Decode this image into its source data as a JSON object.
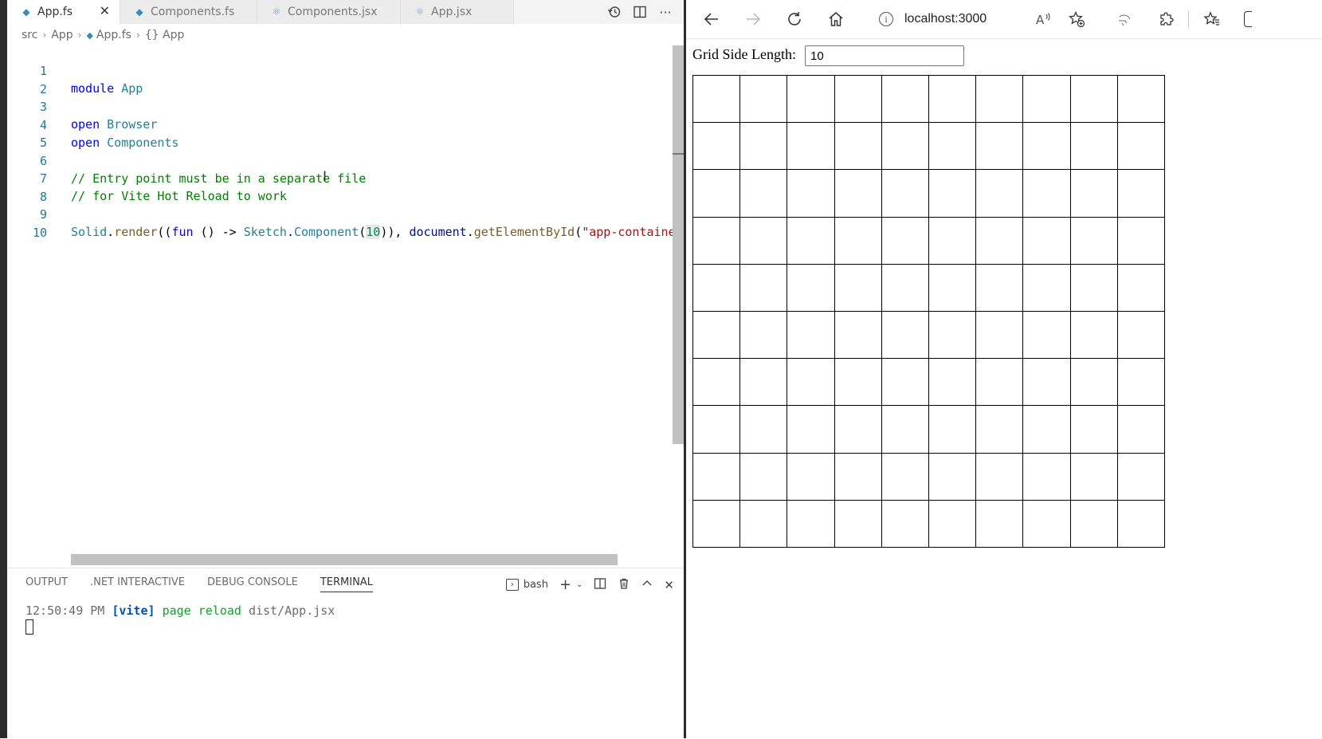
{
  "editor": {
    "tabs": [
      {
        "label": "App.fs",
        "icon": "fsharp-file-icon",
        "active": true
      },
      {
        "label": "Components.fs",
        "icon": "fsharp-file-icon",
        "active": false
      },
      {
        "label": "Components.jsx",
        "icon": "react-file-icon",
        "active": false
      },
      {
        "label": "App.jsx",
        "icon": "react-file-icon",
        "active": false
      }
    ],
    "breadcrumb": {
      "parts": [
        "src",
        "App",
        "App.fs",
        "{} App"
      ]
    },
    "lines": [
      {
        "n": "1"
      },
      {
        "n": "2"
      },
      {
        "n": "3"
      },
      {
        "n": "4"
      },
      {
        "n": "5"
      },
      {
        "n": "6"
      },
      {
        "n": "7"
      },
      {
        "n": "8"
      },
      {
        "n": "9"
      },
      {
        "n": "10"
      }
    ],
    "code": {
      "l1_kw": "module",
      "l1_name": "App",
      "l3_kw": "open",
      "l3_name": "Browser",
      "l4_kw": "open",
      "l4_name": "Components",
      "l6": "// Entry point must be in a separate file",
      "l7": "// for Vite Hot Reload to work",
      "l9_a": "Solid",
      "l9_b": ".",
      "l9_c": "render",
      "l9_d": "((",
      "l9_e": "fun",
      "l9_f": " () -> ",
      "l9_g": "Sketch",
      "l9_h": ".",
      "l9_i": "Component",
      "l9_j": "(",
      "l9_k": "10",
      "l9_l": ")), ",
      "l9_m": "document",
      "l9_n": ".",
      "l9_o": "getElementById",
      "l9_p": "(",
      "l9_q": "\"app-container"
    }
  },
  "panel": {
    "tabs": [
      "OUTPUT",
      ".NET INTERACTIVE",
      "DEBUG CONSOLE",
      "TERMINAL"
    ],
    "active_tab": "TERMINAL",
    "shell": "bash",
    "terminal": {
      "time": "12:50:49 PM",
      "tag": "[vite]",
      "message": "page reload",
      "path": "dist/App.jsx"
    }
  },
  "browser": {
    "url": "localhost:3000",
    "page": {
      "label": "Grid Side Length:",
      "input_value": "10",
      "grid_size": 10
    }
  }
}
